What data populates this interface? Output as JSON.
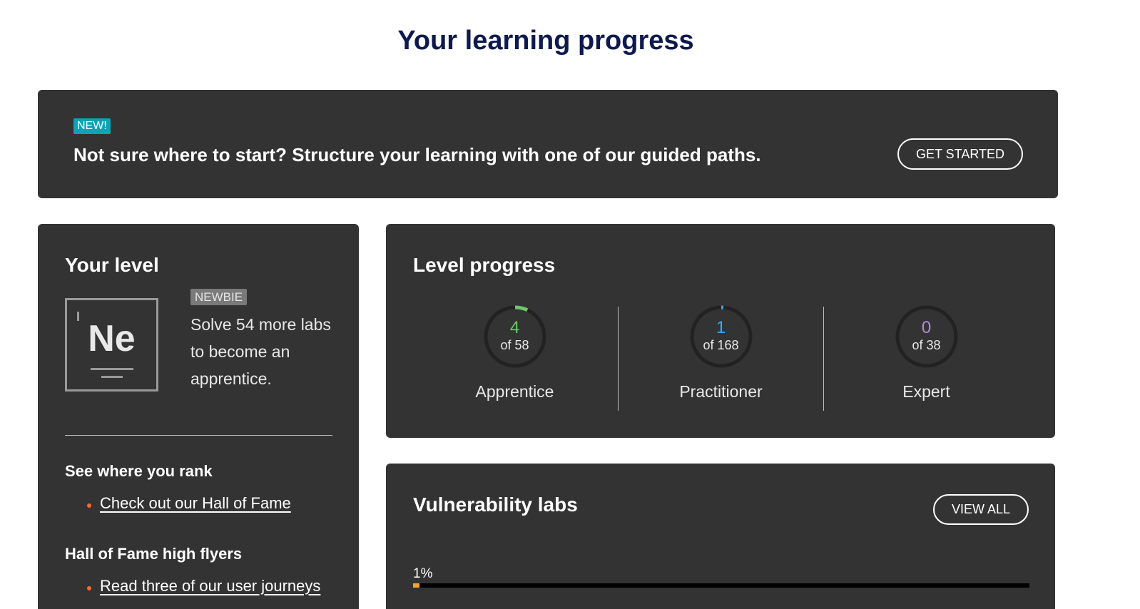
{
  "page": {
    "title": "Your learning progress"
  },
  "banner": {
    "badge": "NEW!",
    "text": "Not sure where to start? Structure your learning with one of our guided paths.",
    "button_label": "GET STARTED"
  },
  "level_card": {
    "heading": "Your level",
    "element_symbol": "Ne",
    "level_badge": "NEWBIE",
    "description": "Solve 54 more labs to become an apprentice.",
    "rank_heading": "See where you rank",
    "rank_link": "Check out our Hall of Fame",
    "flyers_heading": "Hall of Fame high flyers",
    "flyers_link": "Read three of our user journeys"
  },
  "level_progress": {
    "heading": "Level progress",
    "stats": [
      {
        "count": "4",
        "total_label": "of 58",
        "label": "Apprentice",
        "completed": 4,
        "total": 58,
        "color": "#6cc76a"
      },
      {
        "count": "1",
        "total_label": "of 168",
        "label": "Practitioner",
        "completed": 1,
        "total": 168,
        "color": "#3fa9e8"
      },
      {
        "count": "0",
        "total_label": "of 38",
        "label": "Expert",
        "completed": 0,
        "total": 38,
        "color": "#b78ae0"
      }
    ]
  },
  "vulnerability_labs": {
    "heading": "Vulnerability labs",
    "button_label": "VIEW ALL",
    "progress_label": "1%",
    "progress_fraction": 0.01
  },
  "colors": {
    "card_bg": "#333333",
    "title": "#0e1a4e",
    "badge_new": "#0aa3b7",
    "bullet": "#ff6633",
    "progress_fill": "#f5a623"
  }
}
